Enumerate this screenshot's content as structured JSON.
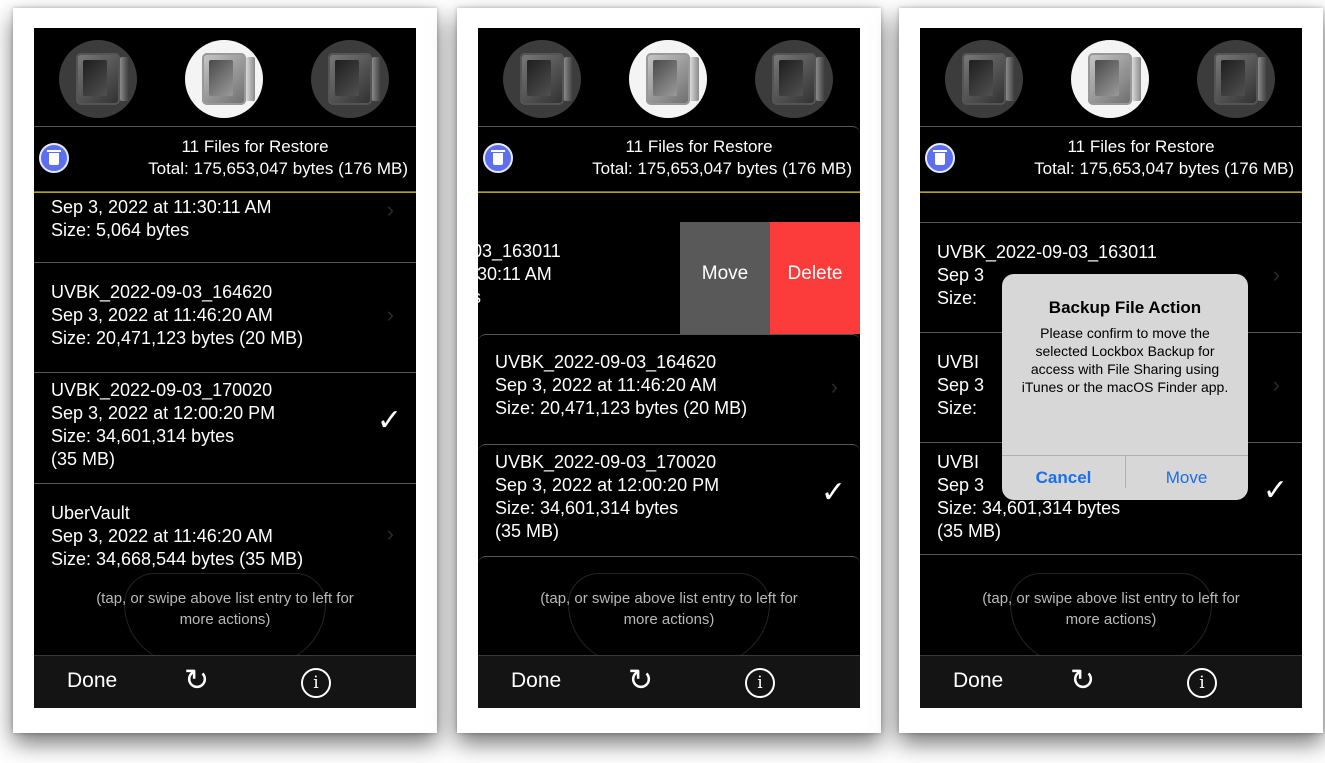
{
  "header": {
    "title": "11 Files for Restore",
    "total": "Total: 175,653,047 bytes (176 MB)"
  },
  "rows": {
    "r0_date": "Sep 3, 2022 at 11:30:11 AM",
    "r0_size": "Size: 5,064 bytes",
    "r1_name": "UVBK_2022-09-03_164620",
    "r1_date": "Sep 3, 2022 at 11:46:20 AM",
    "r1_size": "Size: 20,471,123 bytes (20 MB)",
    "r2_name": "UVBK_2022-09-03_170020",
    "r2_date": "Sep 3, 2022 at 12:00:20 PM",
    "r2_size": "Size: 34,601,314 bytes",
    "r2_size2": "(35 MB)",
    "r3_name": "UberVault",
    "r3_date": "Sep 3, 2022 at 11:46:20 AM",
    "r3_size": "Size: 34,668,544 bytes (35 MB)",
    "swiped_name": "03_163011",
    "swiped_date": ":30:11 AM",
    "swiped_size": "s",
    "s3_name": "UVBK_2022-09-03_163011",
    "s3_date": "Sep 3",
    "s3_size": "Size:",
    "s3_r1_name": "UVBI",
    "s3_r1_date": "Sep 3",
    "s3_r1_size": "Size:",
    "s3_r2_name": "UVBI",
    "s3_r2_date": "Sep 3"
  },
  "swipe_actions": {
    "move": "Move",
    "delete": "Delete"
  },
  "hint": {
    "line1": "(tap, or swipe above list entry to left for",
    "line2": "more actions)"
  },
  "toolbar": {
    "done": "Done",
    "refresh_icon": "refresh-icon",
    "info_icon": "info-icon",
    "refresh_glyph": "↻",
    "info_glyph": "i"
  },
  "alert": {
    "title": "Backup File Action",
    "message": "Please confirm to move the selected Lockbox Backup for access with File Sharing using iTunes or the macOS Finder app.",
    "cancel": "Cancel",
    "move": "Move"
  },
  "colors": {
    "delete": "#fb3c3b",
    "move": "#595959",
    "link": "#1a6ef0",
    "trash": "#5b6ff0"
  },
  "glyphs": {
    "check": "✓",
    "chevron": "›"
  }
}
